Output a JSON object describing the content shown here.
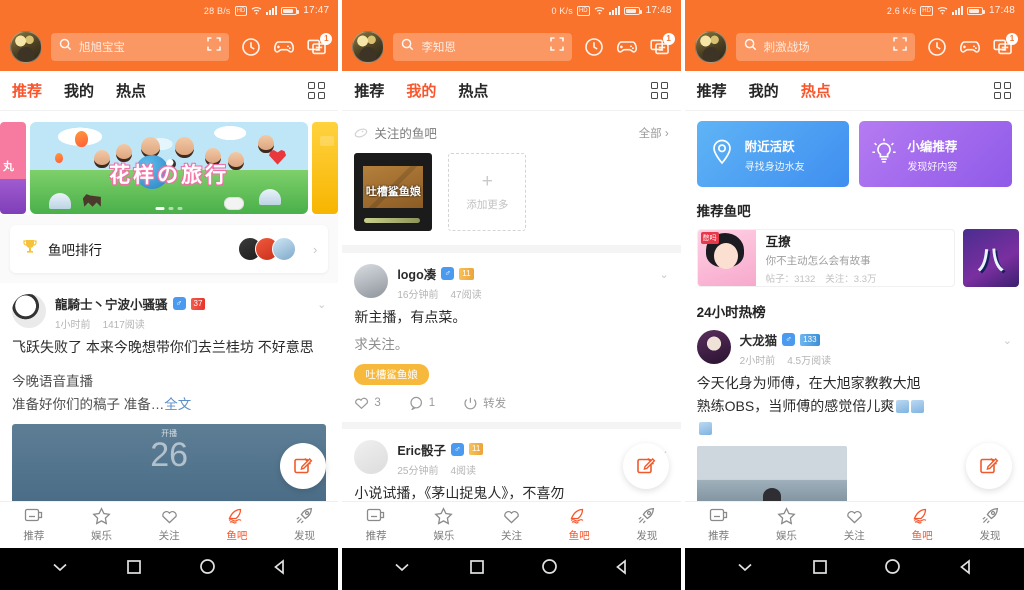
{
  "app": {
    "brand_color": "#f9732c",
    "accent_color": "#f9562d"
  },
  "panels": [
    {
      "status": {
        "net_speed": "28 B/s",
        "hd_label": "HD",
        "time": "17:47"
      },
      "search": {
        "placeholder": "旭旭宝宝"
      },
      "message_badge": "1",
      "tabs": [
        {
          "label": "推荐",
          "active": true
        },
        {
          "label": "我的",
          "active": false
        },
        {
          "label": "热点",
          "active": false
        }
      ],
      "banner": {
        "title": "花样の旅行",
        "left_text": "丸"
      },
      "rank_card": {
        "label": "鱼吧排行",
        "chevron": "›"
      },
      "post": {
        "name": "龍騎士丶宁波小骚骚",
        "sex": "♂",
        "level": "37",
        "time": "1小时前",
        "reads": "1417阅读",
        "text": "飞跃失败了 本来今晚想带你们去兰桂坊 不好意思",
        "text2_line1": "今晚语音直播",
        "text2_line2": "准备好你们的稿子 准备…",
        "more": "全文",
        "image_label": "开播",
        "image_number": "26",
        "caret": "⌄"
      },
      "nav": [
        {
          "label": "推荐",
          "icon": "screen-icon",
          "active": false
        },
        {
          "label": "娱乐",
          "icon": "star-icon",
          "active": false
        },
        {
          "label": "关注",
          "icon": "heart-icon",
          "active": false
        },
        {
          "label": "鱼吧",
          "icon": "fish-icon",
          "active": true
        },
        {
          "label": "发现",
          "icon": "rocket-icon",
          "active": false
        }
      ]
    },
    {
      "status": {
        "net_speed": "0 K/s",
        "hd_label": "HD",
        "time": "17:48"
      },
      "search": {
        "placeholder": "李知恩"
      },
      "message_badge": "1",
      "tabs": [
        {
          "label": "推荐",
          "active": false
        },
        {
          "label": "我的",
          "active": true
        },
        {
          "label": "热点",
          "active": false
        }
      ],
      "followed": {
        "title": "关注的鱼吧",
        "all_label": "全部 ›",
        "card_label": "吐槽鲨鱼娘",
        "add_plus": "+",
        "add_label": "添加更多"
      },
      "posts": [
        {
          "name": "logo凑",
          "sex": "♂",
          "level": "11",
          "time": "16分钟前",
          "reads": "47阅读",
          "text": "新主播，有点菜。",
          "text2": "求关注。",
          "tag": "吐槽鲨鱼娘",
          "likes": "3",
          "comments": "1",
          "share": "转发",
          "caret": "⌄"
        },
        {
          "name": "Eric骰子",
          "sex": "♂",
          "level": "11",
          "time": "25分钟前",
          "reads": "4阅读",
          "text": "小说试播，《茅山捉鬼人》，不喜勿",
          "caret": "⌄"
        }
      ],
      "nav": [
        {
          "label": "推荐",
          "icon": "screen-icon",
          "active": false
        },
        {
          "label": "娱乐",
          "icon": "star-icon",
          "active": false
        },
        {
          "label": "关注",
          "icon": "heart-icon",
          "active": false
        },
        {
          "label": "鱼吧",
          "icon": "fish-icon",
          "active": true
        },
        {
          "label": "发现",
          "icon": "rocket-icon",
          "active": false
        }
      ]
    },
    {
      "status": {
        "net_speed": "2.6 K/s",
        "hd_label": "HD",
        "time": "17:48"
      },
      "search": {
        "placeholder": "刺激战场"
      },
      "message_badge": "1",
      "tabs": [
        {
          "label": "推荐",
          "active": false
        },
        {
          "label": "我的",
          "active": false
        },
        {
          "label": "热点",
          "active": true
        }
      ],
      "promos": [
        {
          "title": "附近活跃",
          "subtitle": "寻找身边水友",
          "icon": "location-pin-icon",
          "color": "#4e9ef2"
        },
        {
          "title": "小编推荐",
          "subtitle": "发现好内容",
          "icon": "lightbulb-icon",
          "color": "#9b63ea"
        }
      ],
      "rec_title": "推荐鱼吧",
      "rec_bar": {
        "name": "互撩",
        "desc": "你不主动怎么会有故事",
        "posts_label": "帖子：3132",
        "follow_label": "关注：3.3万",
        "badge": "憋吗"
      },
      "hot_title": "24小时热榜",
      "post": {
        "name": "大龙猫",
        "sex": "♂",
        "level": "133",
        "time": "2小时前",
        "reads": "4.5万阅读",
        "text_line1": "今天化身为师傅，在大旭家教教大旭",
        "text_line2": "熟练OBS，当师傅的感觉倍儿爽",
        "caret": "⌄"
      },
      "nav": [
        {
          "label": "推荐",
          "icon": "screen-icon",
          "active": false
        },
        {
          "label": "娱乐",
          "icon": "star-icon",
          "active": false
        },
        {
          "label": "关注",
          "icon": "heart-icon",
          "active": false
        },
        {
          "label": "鱼吧",
          "icon": "fish-icon",
          "active": true
        },
        {
          "label": "发现",
          "icon": "rocket-icon",
          "active": false
        }
      ]
    }
  ]
}
